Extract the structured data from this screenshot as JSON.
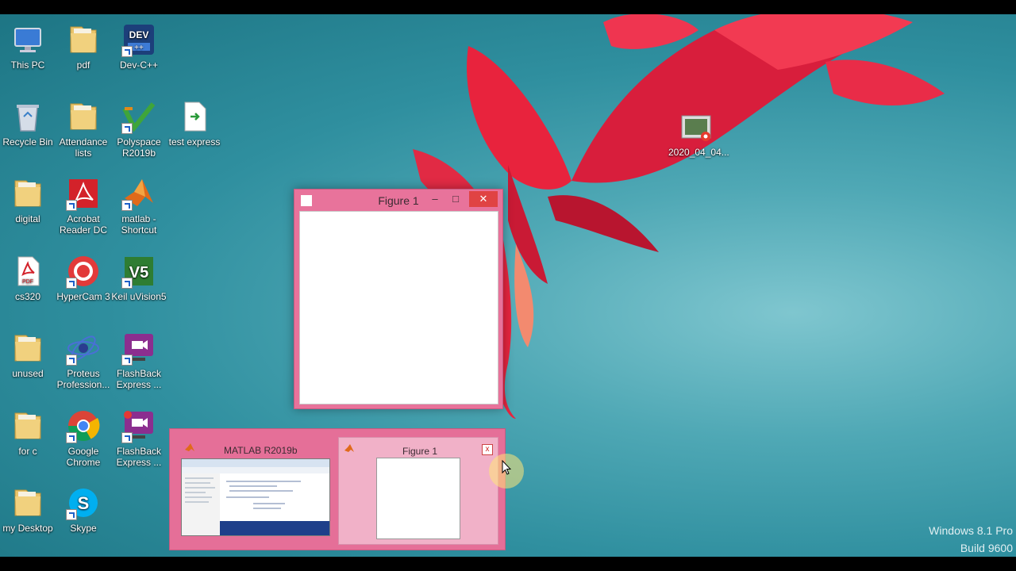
{
  "desktop_icons": [
    {
      "label": "This PC",
      "icon": "computer-icon",
      "shortcut": false
    },
    {
      "label": "pdf",
      "icon": "folder-icon",
      "shortcut": false
    },
    {
      "label": "Dev-C++",
      "icon": "devcpp-icon",
      "shortcut": true
    },
    {
      "label": "Recycle Bin",
      "icon": "recycle-bin-icon",
      "shortcut": false
    },
    {
      "label": "Attendance lists",
      "icon": "folder-icon",
      "shortcut": false
    },
    {
      "label": "Polyspace R2019b",
      "icon": "polyspace-icon",
      "shortcut": true
    },
    {
      "label": "test express",
      "icon": "file-icon",
      "shortcut": false
    },
    {
      "label": "digital",
      "icon": "folder-icon",
      "shortcut": false
    },
    {
      "label": "Acrobat Reader DC",
      "icon": "acrobat-icon",
      "shortcut": true
    },
    {
      "label": "matlab - Shortcut",
      "icon": "matlab-icon",
      "shortcut": true
    },
    {
      "label": "cs320",
      "icon": "pdf-file-icon",
      "shortcut": false
    },
    {
      "label": "HyperCam 3",
      "icon": "hypercam-icon",
      "shortcut": true
    },
    {
      "label": "Keil uVision5",
      "icon": "keil-icon",
      "shortcut": true
    },
    {
      "label": "unused",
      "icon": "folder-icon",
      "shortcut": false
    },
    {
      "label": "Proteus Profession...",
      "icon": "proteus-icon",
      "shortcut": true
    },
    {
      "label": "FlashBack Express ...",
      "icon": "flashback-icon",
      "shortcut": true
    },
    {
      "label": "for c",
      "icon": "folder-icon",
      "shortcut": false
    },
    {
      "label": "Google Chrome",
      "icon": "chrome-icon",
      "shortcut": true
    },
    {
      "label": "FlashBack Express ...",
      "icon": "flashback-rec-icon",
      "shortcut": true
    },
    {
      "label": "my Desktop",
      "icon": "folder-icon",
      "shortcut": false
    },
    {
      "label": "Skype",
      "icon": "skype-icon",
      "shortcut": true
    },
    {
      "label": "2020_04_04...",
      "icon": "video-file-icon",
      "shortcut": false
    }
  ],
  "figure_window": {
    "title": "Figure 1",
    "minimize_glyph": "–",
    "maximize_glyph": "□",
    "close_glyph": "✕"
  },
  "taskbar_thumbnails": {
    "matlab_title": "MATLAB R2019b",
    "figure_title": "Figure 1",
    "close_glyph": "x"
  },
  "watermark": {
    "line1": "Windows 8.1 Pro",
    "line2": "Build 9600"
  },
  "colors": {
    "window_accent": "#e8739b",
    "close_red": "#e04343",
    "desktop_teal": "#2f8f9f"
  }
}
